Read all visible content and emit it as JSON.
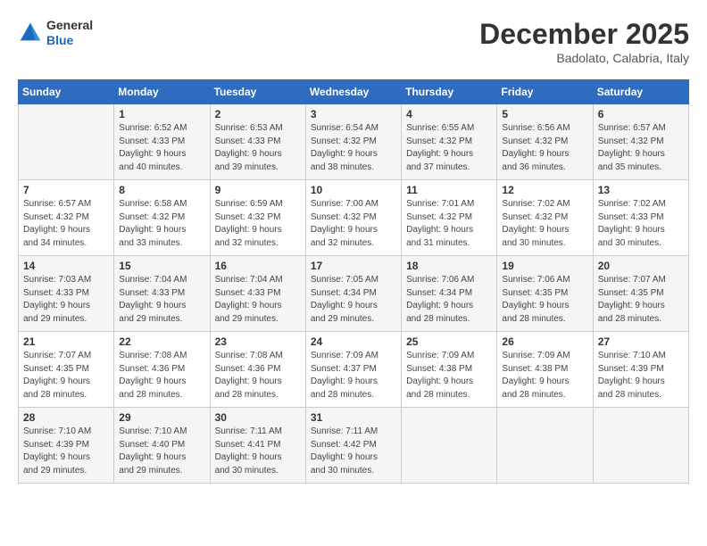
{
  "header": {
    "logo_line1": "General",
    "logo_line2": "Blue",
    "month": "December 2025",
    "location": "Badolato, Calabria, Italy"
  },
  "days_of_week": [
    "Sunday",
    "Monday",
    "Tuesday",
    "Wednesday",
    "Thursday",
    "Friday",
    "Saturday"
  ],
  "weeks": [
    [
      {
        "day": "",
        "info": ""
      },
      {
        "day": "1",
        "info": "Sunrise: 6:52 AM\nSunset: 4:33 PM\nDaylight: 9 hours\nand 40 minutes."
      },
      {
        "day": "2",
        "info": "Sunrise: 6:53 AM\nSunset: 4:33 PM\nDaylight: 9 hours\nand 39 minutes."
      },
      {
        "day": "3",
        "info": "Sunrise: 6:54 AM\nSunset: 4:32 PM\nDaylight: 9 hours\nand 38 minutes."
      },
      {
        "day": "4",
        "info": "Sunrise: 6:55 AM\nSunset: 4:32 PM\nDaylight: 9 hours\nand 37 minutes."
      },
      {
        "day": "5",
        "info": "Sunrise: 6:56 AM\nSunset: 4:32 PM\nDaylight: 9 hours\nand 36 minutes."
      },
      {
        "day": "6",
        "info": "Sunrise: 6:57 AM\nSunset: 4:32 PM\nDaylight: 9 hours\nand 35 minutes."
      }
    ],
    [
      {
        "day": "7",
        "info": "Sunrise: 6:57 AM\nSunset: 4:32 PM\nDaylight: 9 hours\nand 34 minutes."
      },
      {
        "day": "8",
        "info": "Sunrise: 6:58 AM\nSunset: 4:32 PM\nDaylight: 9 hours\nand 33 minutes."
      },
      {
        "day": "9",
        "info": "Sunrise: 6:59 AM\nSunset: 4:32 PM\nDaylight: 9 hours\nand 32 minutes."
      },
      {
        "day": "10",
        "info": "Sunrise: 7:00 AM\nSunset: 4:32 PM\nDaylight: 9 hours\nand 32 minutes."
      },
      {
        "day": "11",
        "info": "Sunrise: 7:01 AM\nSunset: 4:32 PM\nDaylight: 9 hours\nand 31 minutes."
      },
      {
        "day": "12",
        "info": "Sunrise: 7:02 AM\nSunset: 4:32 PM\nDaylight: 9 hours\nand 30 minutes."
      },
      {
        "day": "13",
        "info": "Sunrise: 7:02 AM\nSunset: 4:33 PM\nDaylight: 9 hours\nand 30 minutes."
      }
    ],
    [
      {
        "day": "14",
        "info": "Sunrise: 7:03 AM\nSunset: 4:33 PM\nDaylight: 9 hours\nand 29 minutes."
      },
      {
        "day": "15",
        "info": "Sunrise: 7:04 AM\nSunset: 4:33 PM\nDaylight: 9 hours\nand 29 minutes."
      },
      {
        "day": "16",
        "info": "Sunrise: 7:04 AM\nSunset: 4:33 PM\nDaylight: 9 hours\nand 29 minutes."
      },
      {
        "day": "17",
        "info": "Sunrise: 7:05 AM\nSunset: 4:34 PM\nDaylight: 9 hours\nand 29 minutes."
      },
      {
        "day": "18",
        "info": "Sunrise: 7:06 AM\nSunset: 4:34 PM\nDaylight: 9 hours\nand 28 minutes."
      },
      {
        "day": "19",
        "info": "Sunrise: 7:06 AM\nSunset: 4:35 PM\nDaylight: 9 hours\nand 28 minutes."
      },
      {
        "day": "20",
        "info": "Sunrise: 7:07 AM\nSunset: 4:35 PM\nDaylight: 9 hours\nand 28 minutes."
      }
    ],
    [
      {
        "day": "21",
        "info": "Sunrise: 7:07 AM\nSunset: 4:35 PM\nDaylight: 9 hours\nand 28 minutes."
      },
      {
        "day": "22",
        "info": "Sunrise: 7:08 AM\nSunset: 4:36 PM\nDaylight: 9 hours\nand 28 minutes."
      },
      {
        "day": "23",
        "info": "Sunrise: 7:08 AM\nSunset: 4:36 PM\nDaylight: 9 hours\nand 28 minutes."
      },
      {
        "day": "24",
        "info": "Sunrise: 7:09 AM\nSunset: 4:37 PM\nDaylight: 9 hours\nand 28 minutes."
      },
      {
        "day": "25",
        "info": "Sunrise: 7:09 AM\nSunset: 4:38 PM\nDaylight: 9 hours\nand 28 minutes."
      },
      {
        "day": "26",
        "info": "Sunrise: 7:09 AM\nSunset: 4:38 PM\nDaylight: 9 hours\nand 28 minutes."
      },
      {
        "day": "27",
        "info": "Sunrise: 7:10 AM\nSunset: 4:39 PM\nDaylight: 9 hours\nand 28 minutes."
      }
    ],
    [
      {
        "day": "28",
        "info": "Sunrise: 7:10 AM\nSunset: 4:39 PM\nDaylight: 9 hours\nand 29 minutes."
      },
      {
        "day": "29",
        "info": "Sunrise: 7:10 AM\nSunset: 4:40 PM\nDaylight: 9 hours\nand 29 minutes."
      },
      {
        "day": "30",
        "info": "Sunrise: 7:11 AM\nSunset: 4:41 PM\nDaylight: 9 hours\nand 30 minutes."
      },
      {
        "day": "31",
        "info": "Sunrise: 7:11 AM\nSunset: 4:42 PM\nDaylight: 9 hours\nand 30 minutes."
      },
      {
        "day": "",
        "info": ""
      },
      {
        "day": "",
        "info": ""
      },
      {
        "day": "",
        "info": ""
      }
    ]
  ]
}
